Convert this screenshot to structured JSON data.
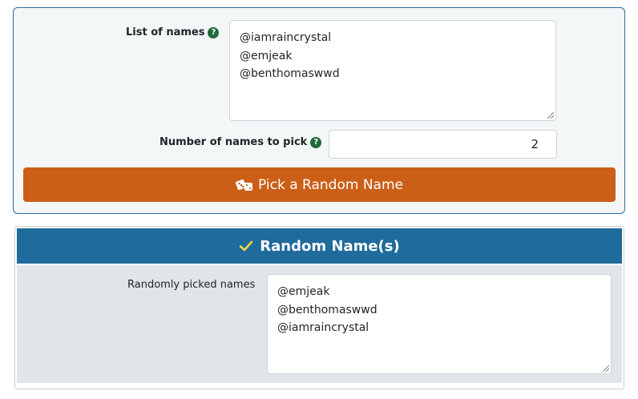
{
  "form": {
    "names_label": "List of names",
    "help_symbol": "?",
    "names": [
      "@iamraincrystal",
      "@emjeak",
      "@benthomaswwd"
    ],
    "count_label": "Number of names to pick",
    "count_value": "2",
    "pick_button_label": "Pick a Random Name"
  },
  "result": {
    "header_title": "Random Name(s)",
    "picked_label": "Randomly picked names",
    "picked_names": [
      "@emjeak",
      "@benthomaswwd",
      "@iamraincrystal"
    ]
  },
  "colors": {
    "primary_blue": "#1f6b9b",
    "button_orange": "#cc5f17",
    "help_green": "#1d6b3a",
    "check_yellow": "#f2d64b"
  },
  "icons": {
    "help": "question-circle-icon",
    "dice": "dice-icon",
    "check": "check-icon"
  }
}
